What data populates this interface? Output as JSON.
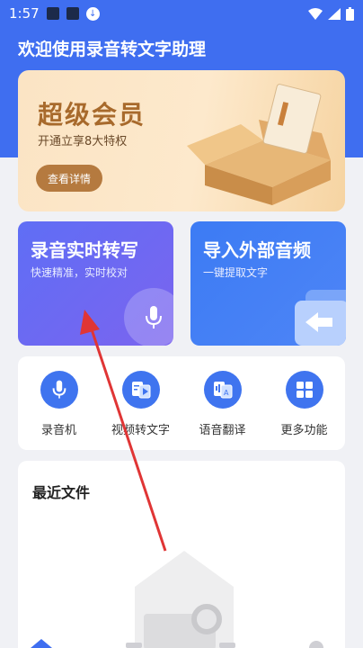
{
  "status_bar": {
    "time": "1:57"
  },
  "app": {
    "title": "欢迎使用录音转文字助理"
  },
  "vip": {
    "title": "超级会员",
    "subtitle": "开通立享8大特权",
    "button_label": "查看详情"
  },
  "features": [
    {
      "title": "录音实时转写",
      "subtitle": "快速精准，实时校对"
    },
    {
      "title": "导入外部音频",
      "subtitle": "一键提取文字"
    }
  ],
  "tools": [
    {
      "label": "录音机",
      "icon": "microphone-icon"
    },
    {
      "label": "视频转文字",
      "icon": "video-to-text-icon"
    },
    {
      "label": "语音翻译",
      "icon": "voice-translate-icon"
    },
    {
      "label": "更多功能",
      "icon": "grid-icon"
    }
  ],
  "recent": {
    "title": "最近文件"
  },
  "colors": {
    "primary": "#3f6ef0",
    "vip_gold": "#a86a2c",
    "vip_button": "#b57a3f",
    "arrow": "#e03535"
  }
}
